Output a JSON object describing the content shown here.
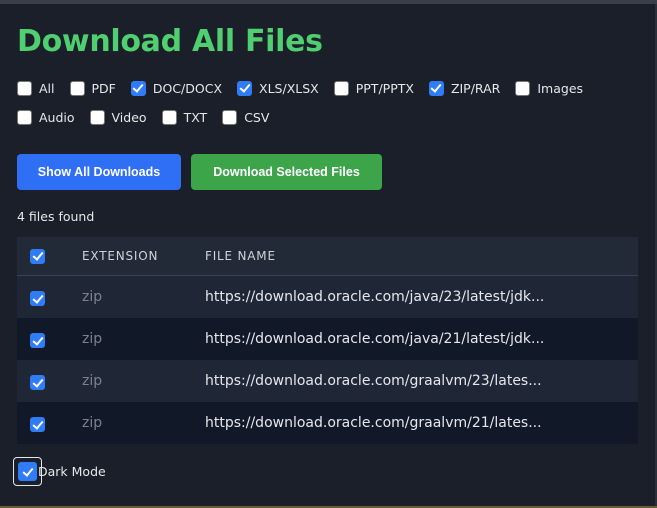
{
  "title": "Download All Files",
  "filters": [
    {
      "label": "All",
      "checked": false
    },
    {
      "label": "PDF",
      "checked": false
    },
    {
      "label": "DOC/DOCX",
      "checked": true
    },
    {
      "label": "XLS/XLSX",
      "checked": true
    },
    {
      "label": "PPT/PPTX",
      "checked": false
    },
    {
      "label": "ZIP/RAR",
      "checked": true
    },
    {
      "label": "Images",
      "checked": false
    },
    {
      "label": "Audio",
      "checked": false
    },
    {
      "label": "Video",
      "checked": false
    },
    {
      "label": "TXT",
      "checked": false
    },
    {
      "label": "CSV",
      "checked": false
    }
  ],
  "buttons": {
    "show_all": "Show All Downloads",
    "download_selected": "Download Selected Files"
  },
  "count_text": "4 files found",
  "table": {
    "headers": {
      "extension": "EXTENSION",
      "file_name": "FILE NAME"
    },
    "select_all_checked": true,
    "rows": [
      {
        "checked": true,
        "extension": "zip",
        "file_name": "https://download.oracle.com/java/23/latest/jdk..."
      },
      {
        "checked": true,
        "extension": "zip",
        "file_name": "https://download.oracle.com/java/21/latest/jdk..."
      },
      {
        "checked": true,
        "extension": "zip",
        "file_name": "https://download.oracle.com/graalvm/23/lates..."
      },
      {
        "checked": true,
        "extension": "zip",
        "file_name": "https://download.oracle.com/graalvm/21/lates..."
      }
    ]
  },
  "dark_mode": {
    "label": "Dark Mode",
    "checked": true
  }
}
